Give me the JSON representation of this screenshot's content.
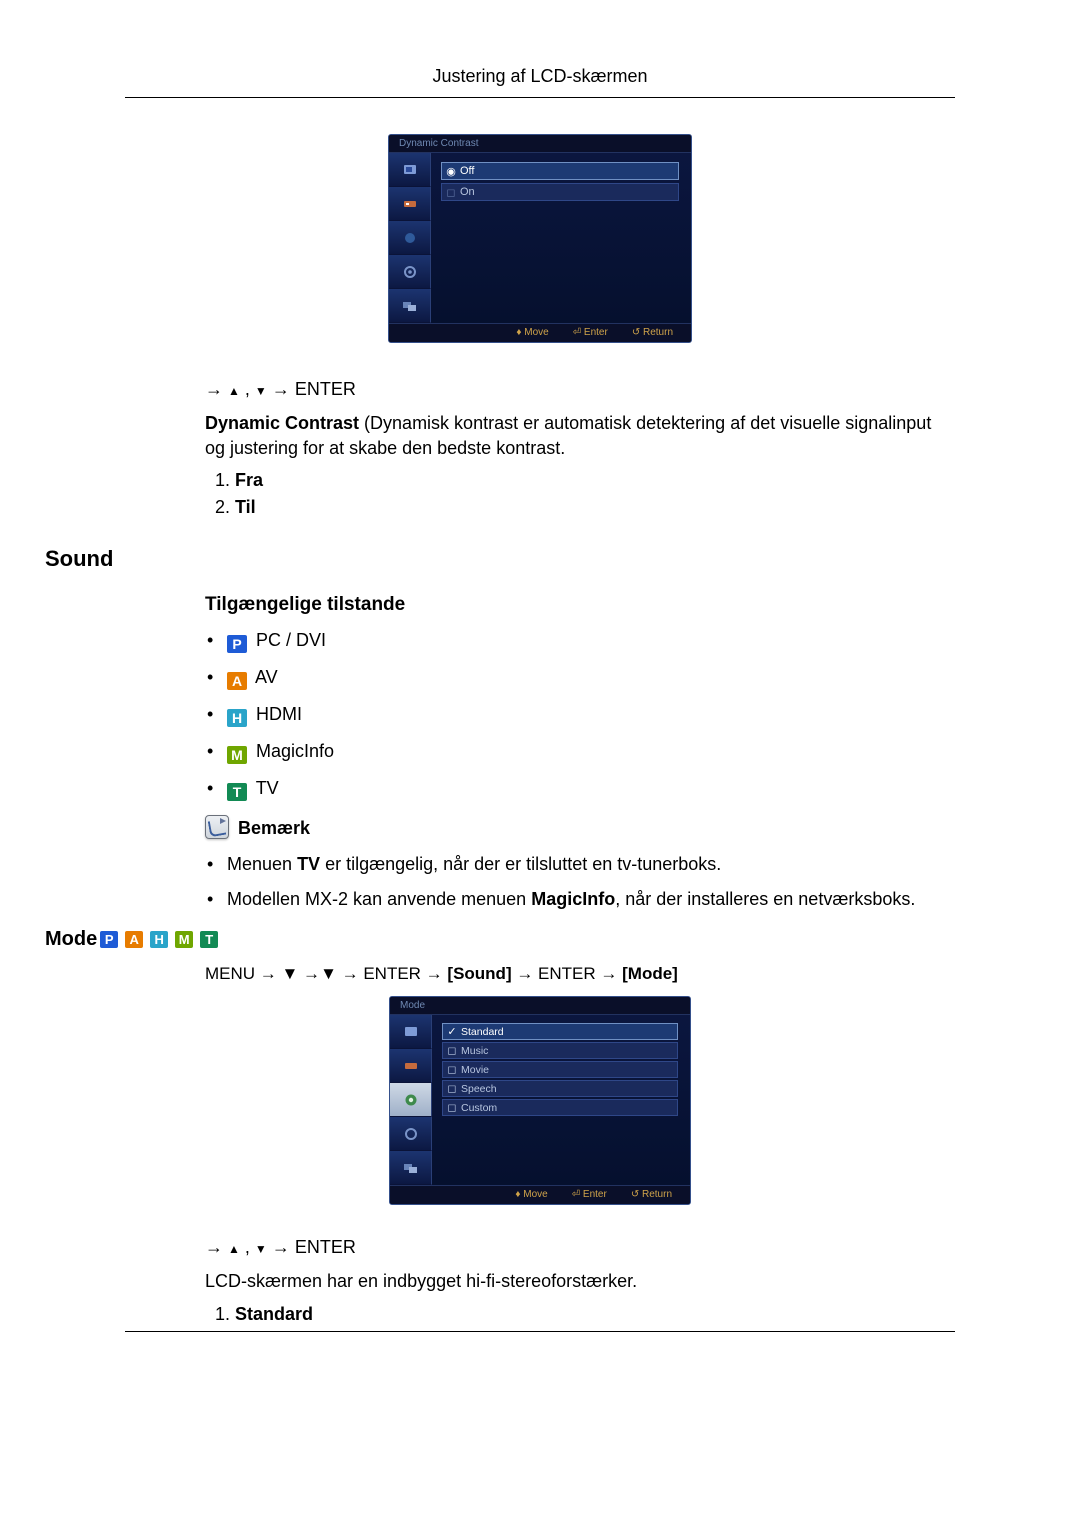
{
  "running_head": "Justering af LCD-skærmen",
  "osd1": {
    "title": "Dynamic Contrast",
    "options": [
      "Off",
      "On"
    ],
    "hints": {
      "move": "Move",
      "enter": "Enter",
      "return": "Return"
    }
  },
  "nav1": {
    "pre": "→ ",
    "mid": " , ",
    "post": " → ENTER"
  },
  "desc1": {
    "strong": "Dynamic Contrast",
    "rest": " (Dynamisk kontrast er automatisk detektering af det visuelle signalinput og justering for at skabe den bedste kontrast."
  },
  "list1": {
    "a": "Fra",
    "b": "Til"
  },
  "section_sound": "Sound",
  "sub_modes": "Tilgængelige tilstande",
  "modes": {
    "p": {
      "letter": "P",
      "label": "PC / DVI"
    },
    "a": {
      "letter": "A",
      "label": "AV"
    },
    "h": {
      "letter": "H",
      "label": "HDMI"
    },
    "m": {
      "letter": "M",
      "label": "MagicInfo"
    },
    "t": {
      "letter": "T",
      "label": "TV"
    }
  },
  "note_label": "Bemærk",
  "note_items": {
    "a": {
      "pre": "Menuen ",
      "b": "TV",
      "post": " er tilgængelig, når der er tilsluttet en tv-tunerboks."
    },
    "b": {
      "pre": "Modellen MX-2 kan anvende menuen ",
      "b": "MagicInfo",
      "post": ", når der installeres en netværksboks."
    }
  },
  "mode_title": "Mode ",
  "menupath": {
    "s1": "MENU → ",
    "s2": " →",
    "s3": " → ENTER → ",
    "b1": "[Sound]",
    "s4": " → ENTER → ",
    "b2": "[Mode]"
  },
  "osd2": {
    "title": "Mode",
    "options": [
      "Standard",
      "Music",
      "Movie",
      "Speech",
      "Custom"
    ],
    "hints": {
      "move": "Move",
      "enter": "Enter",
      "return": "Return"
    }
  },
  "nav2": {
    "pre": "→ ",
    "mid": " , ",
    "post": " → ENTER"
  },
  "desc2": "LCD-skærmen har en indbygget hi-fi-stereoforstærker.",
  "list2": {
    "a": "Standard"
  },
  "glyphs": {
    "up": "▲",
    "down": "▼",
    "diamond": "♦",
    "enter": "⏎",
    "ret": "↺",
    "sel": "✓",
    "box": "◻"
  }
}
